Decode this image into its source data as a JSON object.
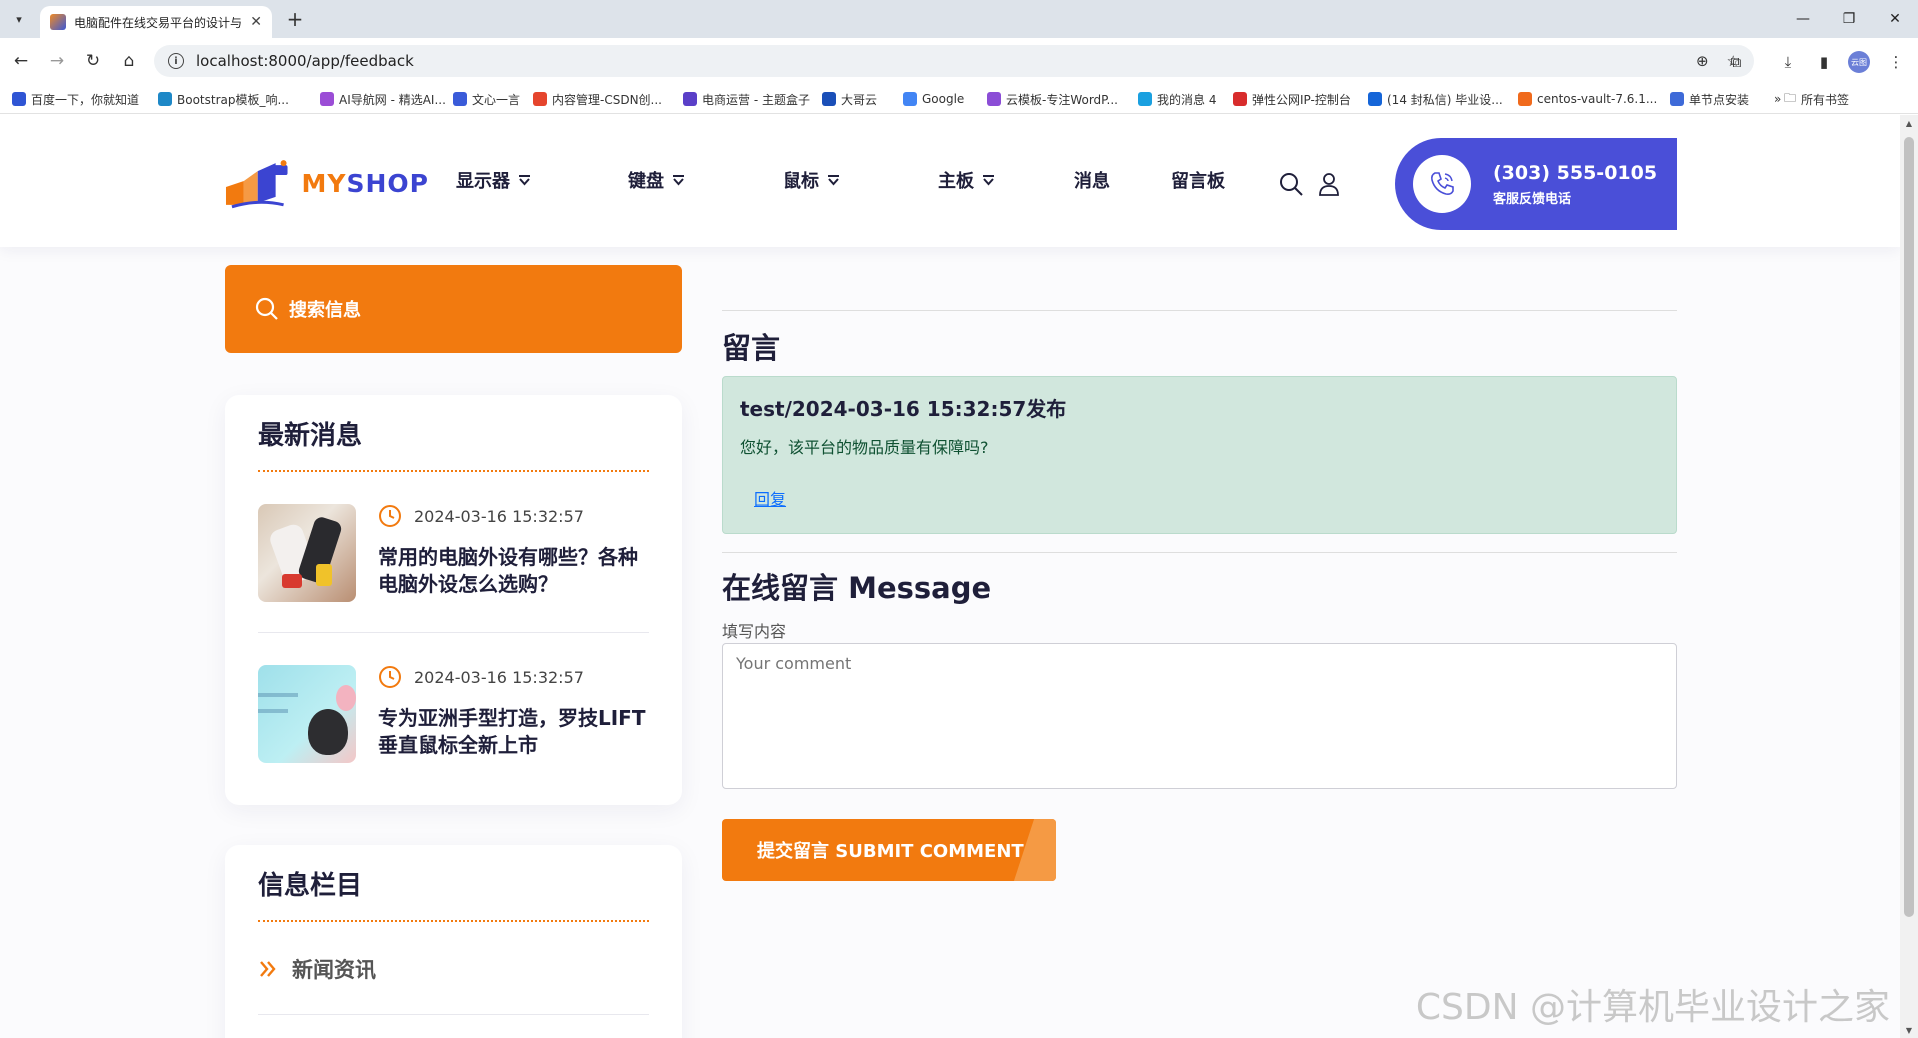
{
  "browser": {
    "tab_title": "电脑配件在线交易平台的设计与",
    "url": "localhost:8000/app/feedback",
    "bookmarks": [
      {
        "label": "百度一下，你就知道",
        "color": "#2f55d4"
      },
      {
        "label": "Bootstrap模板_响...",
        "color": "#1e88c7"
      },
      {
        "label": "AI导航网 - 精选AI...",
        "color": "#9b4dd6"
      },
      {
        "label": "文心一言",
        "color": "#3a5bd9"
      },
      {
        "label": "内容管理-CSDN创...",
        "color": "#e5452d"
      },
      {
        "label": "电商运营 - 主题盒子",
        "color": "#5a3fc8"
      },
      {
        "label": "大哥云",
        "color": "#1a4fb8"
      },
      {
        "label": "Google",
        "color": "#4285f4"
      },
      {
        "label": "云模板-专注WordP...",
        "color": "#8b4dd6"
      },
      {
        "label": "我的消息 4",
        "color": "#1aa0e0"
      },
      {
        "label": "弹性公网IP-控制台",
        "color": "#d82c2c"
      },
      {
        "label": "(14 封私信) 毕业设...",
        "color": "#1565d8"
      },
      {
        "label": "centos-vault-7.6.1...",
        "color": "#f06a1c"
      },
      {
        "label": "单节点安装",
        "color": "#3e6ad8"
      }
    ],
    "all_bookmarks": "所有书签",
    "profile_text": "云图"
  },
  "header": {
    "logo_my": "MY",
    "logo_shop": "SHOP",
    "nav": [
      {
        "label": "显示器",
        "dropdown": true
      },
      {
        "label": "键盘",
        "dropdown": true
      },
      {
        "label": "鼠标",
        "dropdown": true
      },
      {
        "label": "主板",
        "dropdown": true
      },
      {
        "label": "消息",
        "dropdown": false
      },
      {
        "label": "留言板",
        "dropdown": false
      }
    ],
    "phone": "(303) 555-0105",
    "phone_caption": "客服反馈电话"
  },
  "sidebar": {
    "search_placeholder": "搜索信息",
    "latest_title": "最新消息",
    "news": [
      {
        "date": "2024-03-16 15:32:57",
        "title": "常用的电脑外设有哪些？各种电脑外设怎么选购？"
      },
      {
        "date": "2024-03-16 15:32:57",
        "title": "专为亚洲手型打造，罗技LIFT垂直鼠标全新上市"
      }
    ],
    "category_title": "信息栏目",
    "categories": [
      "新闻资讯"
    ]
  },
  "main": {
    "section_title": "留言",
    "comment": {
      "header": "test/2024-03-16 15:32:57发布",
      "body": "您好，该平台的物品质量有保障吗?",
      "reply_label": "回复"
    },
    "form_title": "在线留言 Message",
    "field_label": "填写内容",
    "textarea_placeholder": "Your comment",
    "submit_label": "提交留言 SUBMIT COMMENT"
  },
  "watermark": "CSDN @计算机毕业设计之家",
  "colors": {
    "accent_orange": "#f27a0f",
    "brand_blue": "#4a4fd8",
    "comment_green": "#d1e7dd"
  }
}
